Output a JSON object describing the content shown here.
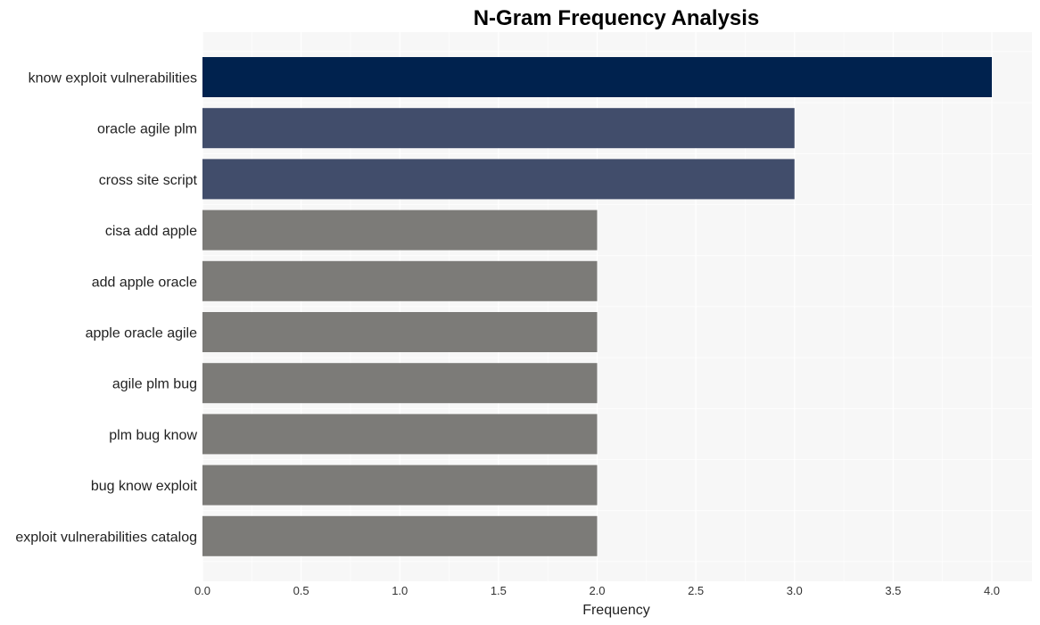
{
  "chart_data": {
    "type": "bar",
    "orientation": "horizontal",
    "title": "N-Gram Frequency Analysis",
    "xlabel": "Frequency",
    "ylabel": "",
    "xlim": [
      0,
      4.2
    ],
    "x_ticks": [
      "0.0",
      "0.5",
      "1.0",
      "1.5",
      "2.0",
      "2.5",
      "3.0",
      "3.5",
      "4.0"
    ],
    "x_tick_values": [
      0,
      0.5,
      1.0,
      1.5,
      2.0,
      2.5,
      3.0,
      3.5,
      4.0
    ],
    "grid": true,
    "categories": [
      "know exploit vulnerabilities",
      "oracle agile plm",
      "cross site script",
      "cisa add apple",
      "add apple oracle",
      "apple oracle agile",
      "agile plm bug",
      "plm bug know",
      "bug know exploit",
      "exploit vulnerabilities catalog"
    ],
    "values": [
      4,
      3,
      3,
      2,
      2,
      2,
      2,
      2,
      2,
      2
    ],
    "colors": [
      "#00224e",
      "#414d6b",
      "#414d6b",
      "#7c7b78",
      "#7c7b78",
      "#7c7b78",
      "#7c7b78",
      "#7c7b78",
      "#7c7b78",
      "#7c7b78"
    ],
    "background_color": "#f7f7f7",
    "grid_color": "#ffffff"
  }
}
